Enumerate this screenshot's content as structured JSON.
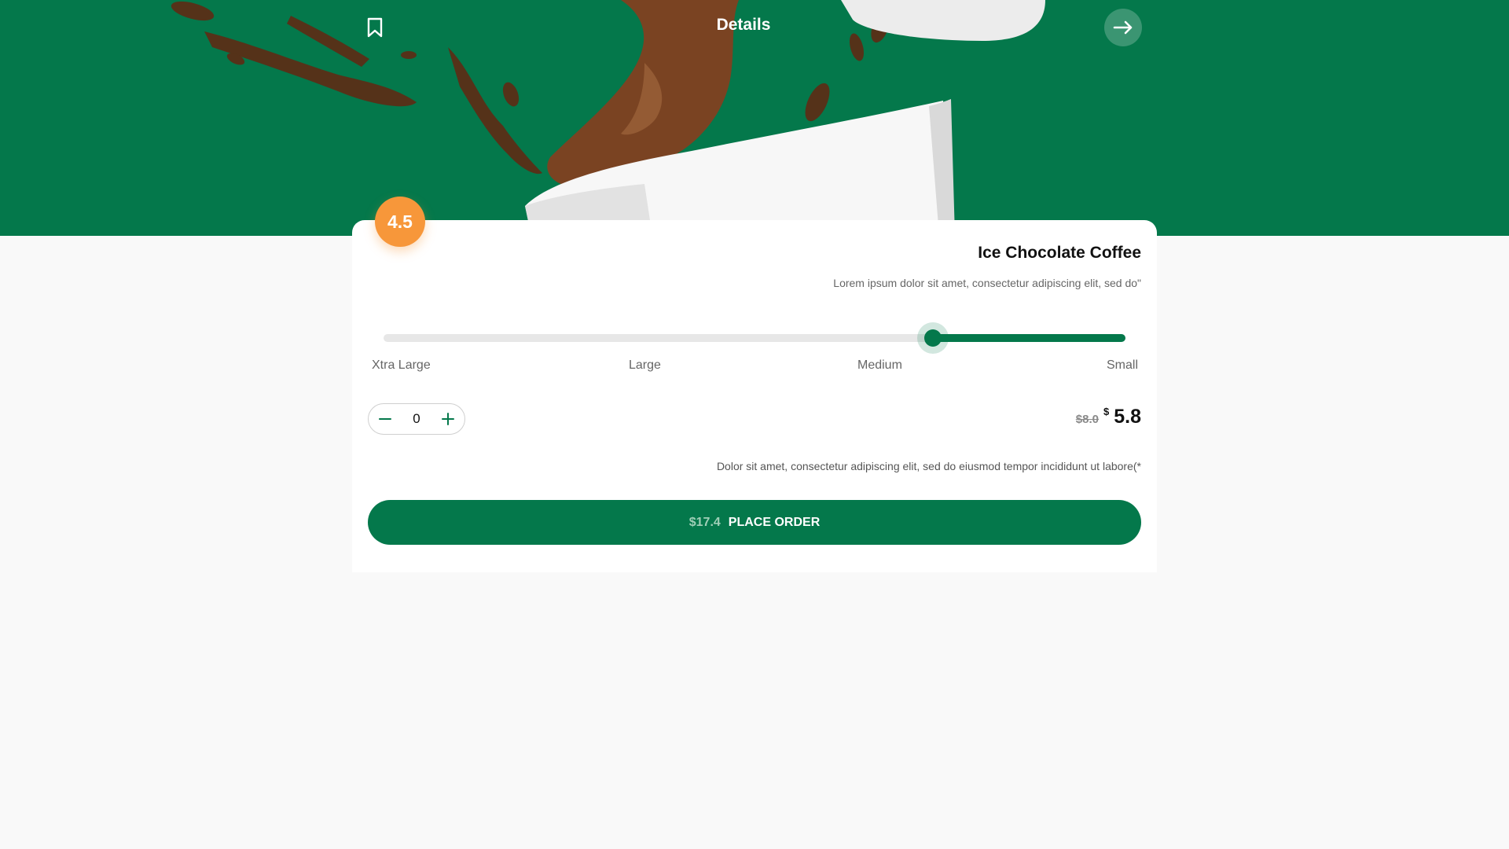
{
  "colors": {
    "brand_green": "#04784b",
    "rating_orange": "#f7973a",
    "page_background": "#f9f9f9"
  },
  "header": {
    "title": "Details",
    "bookmark_icon": "bookmark-icon",
    "forward_icon": "arrow-right-icon"
  },
  "product": {
    "rating": "4.5",
    "name": "Ice Chocolate Coffee",
    "description": "Lorem ipsum dolor sit amet, consectetur adipiscing elit, sed do\"",
    "note": "Dolor sit amet, consectetur adipiscing elit, sed do eiusmod tempor incididunt ut labore(*"
  },
  "size_selector": {
    "options": [
      "Xtra Large",
      "Large",
      "Medium",
      "Small"
    ],
    "selected_position": 0.74
  },
  "quantity": {
    "value": "0",
    "decrement_icon": "minus-icon",
    "increment_icon": "plus-icon"
  },
  "price": {
    "old": "$8.0",
    "currency": "$",
    "current": "5.8"
  },
  "order": {
    "total": "$17.4",
    "label": "PLACE ORDER"
  }
}
